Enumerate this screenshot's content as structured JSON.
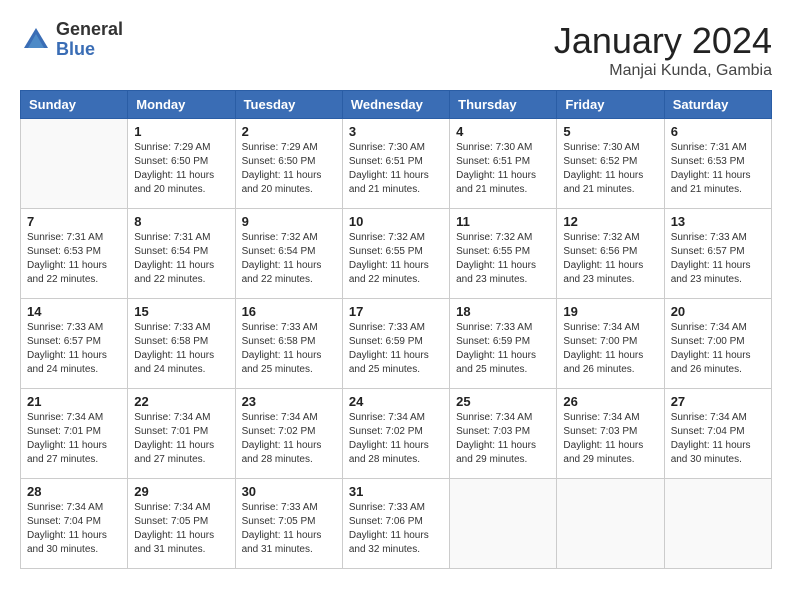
{
  "logo": {
    "general": "General",
    "blue": "Blue"
  },
  "title": "January 2024",
  "location": "Manjai Kunda, Gambia",
  "weekdays": [
    "Sunday",
    "Monday",
    "Tuesday",
    "Wednesday",
    "Thursday",
    "Friday",
    "Saturday"
  ],
  "weeks": [
    [
      {
        "day": "",
        "sunrise": "",
        "sunset": "",
        "daylight": ""
      },
      {
        "day": "1",
        "sunrise": "Sunrise: 7:29 AM",
        "sunset": "Sunset: 6:50 PM",
        "daylight": "Daylight: 11 hours and 20 minutes."
      },
      {
        "day": "2",
        "sunrise": "Sunrise: 7:29 AM",
        "sunset": "Sunset: 6:50 PM",
        "daylight": "Daylight: 11 hours and 20 minutes."
      },
      {
        "day": "3",
        "sunrise": "Sunrise: 7:30 AM",
        "sunset": "Sunset: 6:51 PM",
        "daylight": "Daylight: 11 hours and 21 minutes."
      },
      {
        "day": "4",
        "sunrise": "Sunrise: 7:30 AM",
        "sunset": "Sunset: 6:51 PM",
        "daylight": "Daylight: 11 hours and 21 minutes."
      },
      {
        "day": "5",
        "sunrise": "Sunrise: 7:30 AM",
        "sunset": "Sunset: 6:52 PM",
        "daylight": "Daylight: 11 hours and 21 minutes."
      },
      {
        "day": "6",
        "sunrise": "Sunrise: 7:31 AM",
        "sunset": "Sunset: 6:53 PM",
        "daylight": "Daylight: 11 hours and 21 minutes."
      }
    ],
    [
      {
        "day": "7",
        "sunrise": "Sunrise: 7:31 AM",
        "sunset": "Sunset: 6:53 PM",
        "daylight": "Daylight: 11 hours and 22 minutes."
      },
      {
        "day": "8",
        "sunrise": "Sunrise: 7:31 AM",
        "sunset": "Sunset: 6:54 PM",
        "daylight": "Daylight: 11 hours and 22 minutes."
      },
      {
        "day": "9",
        "sunrise": "Sunrise: 7:32 AM",
        "sunset": "Sunset: 6:54 PM",
        "daylight": "Daylight: 11 hours and 22 minutes."
      },
      {
        "day": "10",
        "sunrise": "Sunrise: 7:32 AM",
        "sunset": "Sunset: 6:55 PM",
        "daylight": "Daylight: 11 hours and 22 minutes."
      },
      {
        "day": "11",
        "sunrise": "Sunrise: 7:32 AM",
        "sunset": "Sunset: 6:55 PM",
        "daylight": "Daylight: 11 hours and 23 minutes."
      },
      {
        "day": "12",
        "sunrise": "Sunrise: 7:32 AM",
        "sunset": "Sunset: 6:56 PM",
        "daylight": "Daylight: 11 hours and 23 minutes."
      },
      {
        "day": "13",
        "sunrise": "Sunrise: 7:33 AM",
        "sunset": "Sunset: 6:57 PM",
        "daylight": "Daylight: 11 hours and 23 minutes."
      }
    ],
    [
      {
        "day": "14",
        "sunrise": "Sunrise: 7:33 AM",
        "sunset": "Sunset: 6:57 PM",
        "daylight": "Daylight: 11 hours and 24 minutes."
      },
      {
        "day": "15",
        "sunrise": "Sunrise: 7:33 AM",
        "sunset": "Sunset: 6:58 PM",
        "daylight": "Daylight: 11 hours and 24 minutes."
      },
      {
        "day": "16",
        "sunrise": "Sunrise: 7:33 AM",
        "sunset": "Sunset: 6:58 PM",
        "daylight": "Daylight: 11 hours and 25 minutes."
      },
      {
        "day": "17",
        "sunrise": "Sunrise: 7:33 AM",
        "sunset": "Sunset: 6:59 PM",
        "daylight": "Daylight: 11 hours and 25 minutes."
      },
      {
        "day": "18",
        "sunrise": "Sunrise: 7:33 AM",
        "sunset": "Sunset: 6:59 PM",
        "daylight": "Daylight: 11 hours and 25 minutes."
      },
      {
        "day": "19",
        "sunrise": "Sunrise: 7:34 AM",
        "sunset": "Sunset: 7:00 PM",
        "daylight": "Daylight: 11 hours and 26 minutes."
      },
      {
        "day": "20",
        "sunrise": "Sunrise: 7:34 AM",
        "sunset": "Sunset: 7:00 PM",
        "daylight": "Daylight: 11 hours and 26 minutes."
      }
    ],
    [
      {
        "day": "21",
        "sunrise": "Sunrise: 7:34 AM",
        "sunset": "Sunset: 7:01 PM",
        "daylight": "Daylight: 11 hours and 27 minutes."
      },
      {
        "day": "22",
        "sunrise": "Sunrise: 7:34 AM",
        "sunset": "Sunset: 7:01 PM",
        "daylight": "Daylight: 11 hours and 27 minutes."
      },
      {
        "day": "23",
        "sunrise": "Sunrise: 7:34 AM",
        "sunset": "Sunset: 7:02 PM",
        "daylight": "Daylight: 11 hours and 28 minutes."
      },
      {
        "day": "24",
        "sunrise": "Sunrise: 7:34 AM",
        "sunset": "Sunset: 7:02 PM",
        "daylight": "Daylight: 11 hours and 28 minutes."
      },
      {
        "day": "25",
        "sunrise": "Sunrise: 7:34 AM",
        "sunset": "Sunset: 7:03 PM",
        "daylight": "Daylight: 11 hours and 29 minutes."
      },
      {
        "day": "26",
        "sunrise": "Sunrise: 7:34 AM",
        "sunset": "Sunset: 7:03 PM",
        "daylight": "Daylight: 11 hours and 29 minutes."
      },
      {
        "day": "27",
        "sunrise": "Sunrise: 7:34 AM",
        "sunset": "Sunset: 7:04 PM",
        "daylight": "Daylight: 11 hours and 30 minutes."
      }
    ],
    [
      {
        "day": "28",
        "sunrise": "Sunrise: 7:34 AM",
        "sunset": "Sunset: 7:04 PM",
        "daylight": "Daylight: 11 hours and 30 minutes."
      },
      {
        "day": "29",
        "sunrise": "Sunrise: 7:34 AM",
        "sunset": "Sunset: 7:05 PM",
        "daylight": "Daylight: 11 hours and 31 minutes."
      },
      {
        "day": "30",
        "sunrise": "Sunrise: 7:33 AM",
        "sunset": "Sunset: 7:05 PM",
        "daylight": "Daylight: 11 hours and 31 minutes."
      },
      {
        "day": "31",
        "sunrise": "Sunrise: 7:33 AM",
        "sunset": "Sunset: 7:06 PM",
        "daylight": "Daylight: 11 hours and 32 minutes."
      },
      {
        "day": "",
        "sunrise": "",
        "sunset": "",
        "daylight": ""
      },
      {
        "day": "",
        "sunrise": "",
        "sunset": "",
        "daylight": ""
      },
      {
        "day": "",
        "sunrise": "",
        "sunset": "",
        "daylight": ""
      }
    ]
  ]
}
